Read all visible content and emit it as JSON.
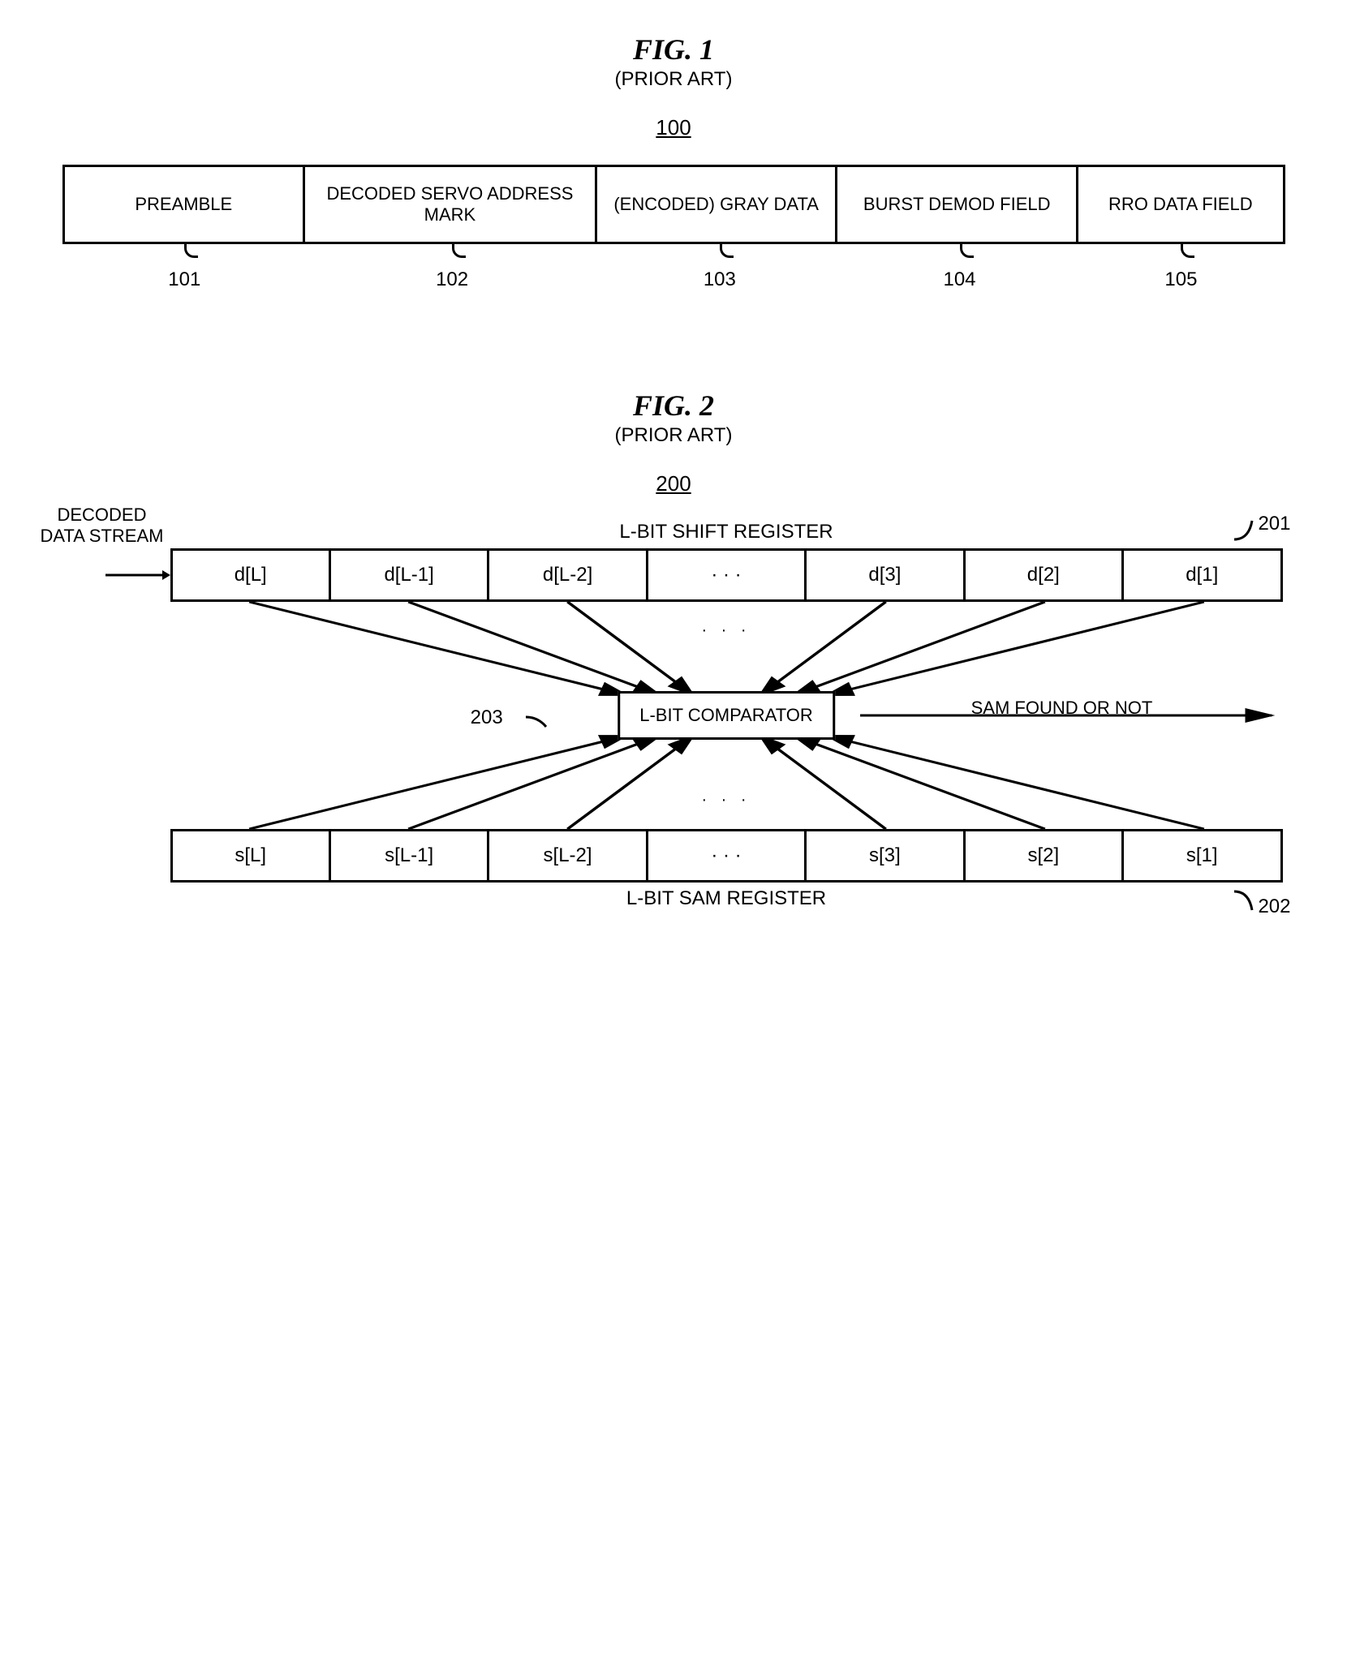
{
  "fig1": {
    "title": "FIG. 1",
    "subtitle": "(PRIOR ART)",
    "ref": "100",
    "cells": {
      "c0": "PREAMBLE",
      "c1": "DECODED SERVO ADDRESS MARK",
      "c2": "(ENCODED) GRAY DATA",
      "c3": "BURST DEMOD FIELD",
      "c4": "RRO DATA FIELD"
    },
    "labels": {
      "l0": "101",
      "l1": "102",
      "l2": "103",
      "l3": "104",
      "l4": "105"
    }
  },
  "fig2": {
    "title": "FIG. 2",
    "subtitle": "(PRIOR ART)",
    "ref": "200",
    "top_reg_label": "L-BIT SHIFT REGISTER",
    "bottom_reg_label": "L-BIT SAM REGISTER",
    "input_label_1": "DECODED",
    "input_label_2": "DATA STREAM",
    "top_cells": {
      "c0": "d[L]",
      "c1": "d[L-1]",
      "c2": "d[L-2]",
      "c3": "· · ·",
      "c4": "d[3]",
      "c5": "d[2]",
      "c6": "d[1]"
    },
    "bottom_cells": {
      "c0": "s[L]",
      "c1": "s[L-1]",
      "c2": "s[L-2]",
      "c3": "· · ·",
      "c4": "s[3]",
      "c5": "s[2]",
      "c6": "s[1]"
    },
    "comparator": "L-BIT COMPARATOR",
    "comp_ref": "203",
    "output": "SAM FOUND OR NOT",
    "ref_201": "201",
    "ref_202": "202"
  }
}
